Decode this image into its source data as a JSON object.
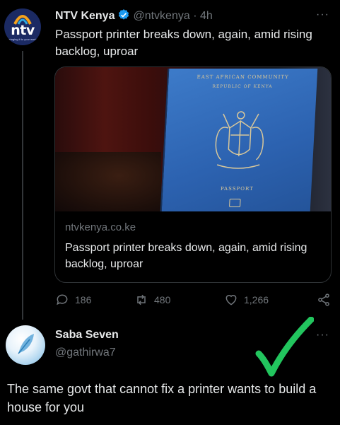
{
  "tweet": {
    "author_name": "NTV Kenya",
    "handle_time": "@ntvkenya · 4h",
    "more_label": "···",
    "avatar": {
      "logo_text": "ntv",
      "tagline": "bringing it to your world"
    },
    "text": "Passport printer breaks down, again, amid rising backlog, uproar",
    "card": {
      "image_text": {
        "line1": "EAST AFRICAN COMMUNITY",
        "line2": "REPUBLIC OF KENYA",
        "line3": "PASSPORT"
      },
      "domain": "ntvkenya.co.ke",
      "title": "Passport printer breaks down, again, amid rising backlog, uproar"
    },
    "actions": {
      "replies": "186",
      "retweets": "480",
      "likes": "1,266"
    }
  },
  "reply": {
    "author_name": "Saba Seven",
    "handle": "@gathirwa7",
    "more_label": "···",
    "text": "The same govt that cannot fix a printer wants to build a house for you"
  },
  "colors": {
    "background": "#000000",
    "text": "#e7e9ea",
    "muted": "#71767b",
    "verified": "#1d9bf0",
    "checkmark": "#22c55e"
  },
  "icons": [
    "verified-badge-icon",
    "reply-icon",
    "retweet-icon",
    "like-icon",
    "share-icon",
    "more-icon",
    "checkmark-icon"
  ]
}
